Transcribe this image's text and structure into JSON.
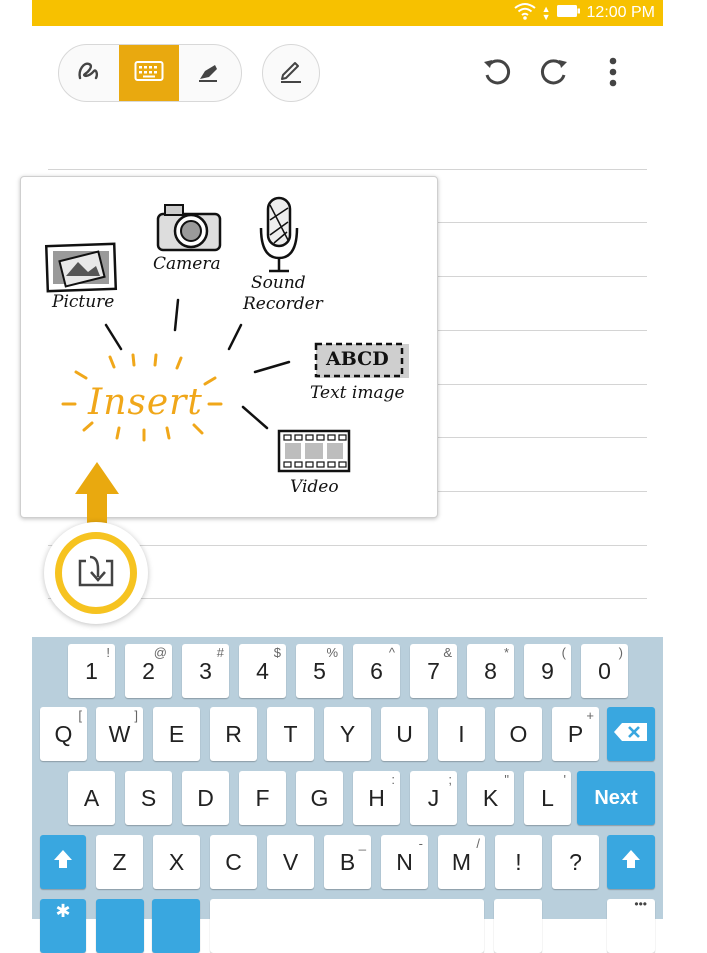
{
  "status_bar": {
    "time": "12:00 PM",
    "icons": [
      "wifi-icon",
      "battery-icon"
    ]
  },
  "toolbar": {
    "modes": [
      "handwriting-icon",
      "keyboard-icon",
      "highlighter-icon"
    ],
    "active_mode": "keyboard-icon",
    "pen_style_icon": "pen-style-icon",
    "undo_icon": "undo-icon",
    "redo_icon": "redo-icon",
    "more_icon": "more-vertical-icon"
  },
  "insert_panel": {
    "title": "Insert",
    "options": {
      "picture": "Picture",
      "camera": "Camera",
      "sound_recorder_line1": "Sound",
      "sound_recorder_line2": "Recorder",
      "text_image": "Text image",
      "text_image_sample": "ABCD",
      "video": "Video"
    }
  },
  "insert_button_icon": "insert-icon",
  "keyboard": {
    "row1": [
      {
        "main": "1",
        "sec": "!"
      },
      {
        "main": "2",
        "sec": "@"
      },
      {
        "main": "3",
        "sec": "#"
      },
      {
        "main": "4",
        "sec": "$"
      },
      {
        "main": "5",
        "sec": "%"
      },
      {
        "main": "6",
        "sec": "^"
      },
      {
        "main": "7",
        "sec": "&"
      },
      {
        "main": "8",
        "sec": "*"
      },
      {
        "main": "9",
        "sec": "("
      },
      {
        "main": "0",
        "sec": ")"
      }
    ],
    "row2": [
      {
        "main": "Q",
        "sec": "["
      },
      {
        "main": "W",
        "sec": "]"
      },
      {
        "main": "E",
        "sec": ""
      },
      {
        "main": "R",
        "sec": ""
      },
      {
        "main": "T",
        "sec": ""
      },
      {
        "main": "Y",
        "sec": ""
      },
      {
        "main": "U",
        "sec": ""
      },
      {
        "main": "I",
        "sec": ""
      },
      {
        "main": "O",
        "sec": ""
      },
      {
        "main": "P",
        "sec": "+"
      }
    ],
    "row3": [
      {
        "main": "A",
        "sec": ""
      },
      {
        "main": "S",
        "sec": ""
      },
      {
        "main": "D",
        "sec": ""
      },
      {
        "main": "F",
        "sec": ""
      },
      {
        "main": "G",
        "sec": ""
      },
      {
        "main": "H",
        "sec": ":"
      },
      {
        "main": "J",
        "sec": ";"
      },
      {
        "main": "K",
        "sec": "\""
      },
      {
        "main": "L",
        "sec": "'"
      }
    ],
    "row4": [
      {
        "main": "Z",
        "sec": ""
      },
      {
        "main": "X",
        "sec": ""
      },
      {
        "main": "C",
        "sec": ""
      },
      {
        "main": "V",
        "sec": ""
      },
      {
        "main": "B",
        "sec": "_"
      },
      {
        "main": "N",
        "sec": "-"
      },
      {
        "main": "M",
        "sec": "/"
      },
      {
        "main": "!",
        "sec": ""
      },
      {
        "main": "?",
        "sec": ""
      }
    ],
    "next_label": "Next",
    "backspace_icon": "backspace-icon",
    "shift_icon": "shift-icon",
    "accent_color": "#39a7e0",
    "background_color": "#b9cfdc"
  },
  "colors": {
    "status_bar": "#f7c100",
    "accent": "#e9a90f",
    "insert_text": "#f0a71a"
  }
}
